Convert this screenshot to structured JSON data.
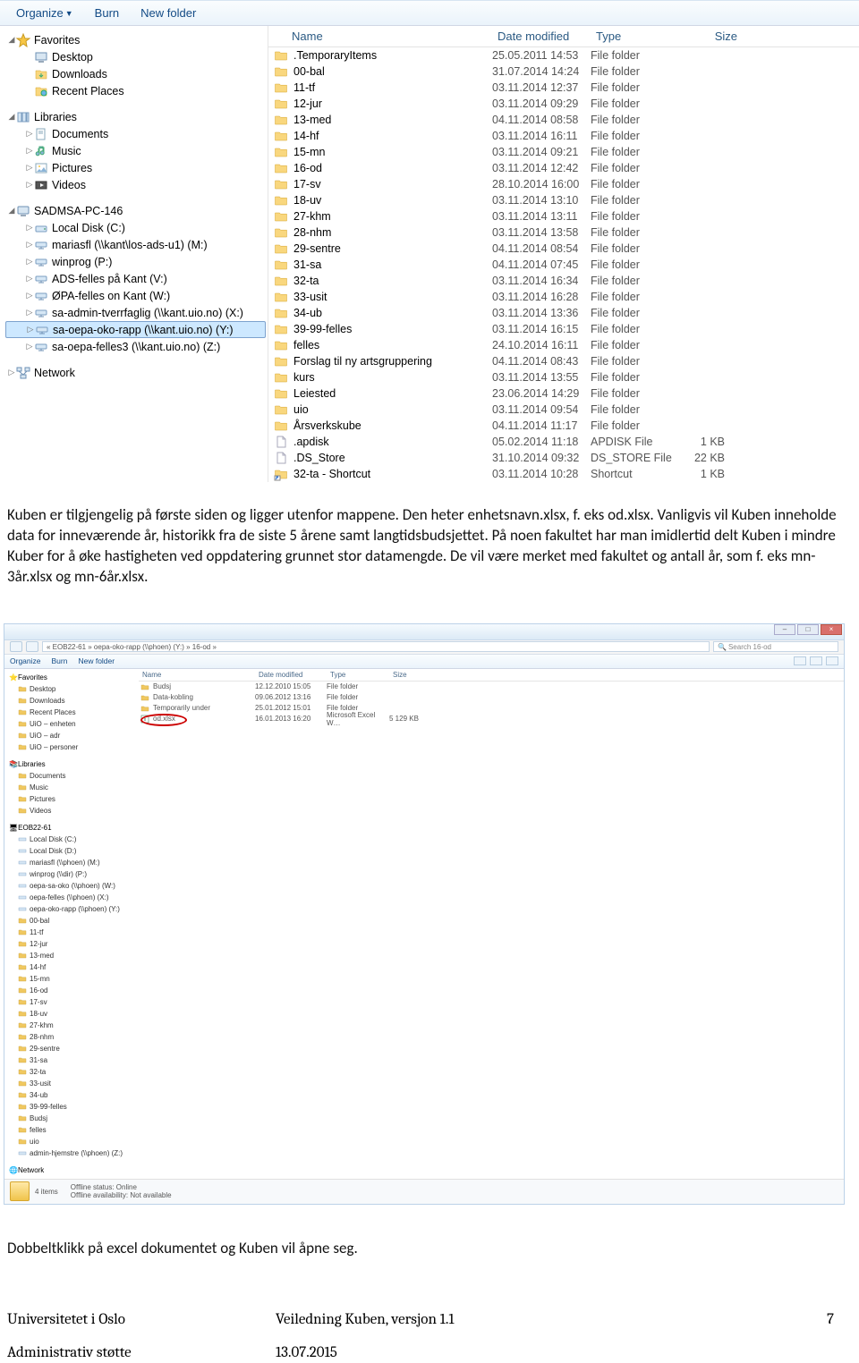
{
  "toolbar": {
    "organize": "Organize",
    "burn": "Burn",
    "newfolder": "New folder"
  },
  "navpane": {
    "favorites": {
      "header": "Favorites",
      "items": [
        "Desktop",
        "Downloads",
        "Recent Places"
      ]
    },
    "libraries": {
      "header": "Libraries",
      "items": [
        "Documents",
        "Music",
        "Pictures",
        "Videos"
      ]
    },
    "computer": {
      "header": "SADMSA-PC-146",
      "items": [
        "Local Disk (C:)",
        "mariasfl (\\\\kant\\los-ads-u1) (M:)",
        "winprog (P:)",
        "ADS-felles på Kant (V:)",
        "ØPA-felles on Kant (W:)",
        "sa-admin-tverrfaglig (\\\\kant.uio.no) (X:)",
        "sa-oepa-oko-rapp (\\\\kant.uio.no) (Y:)",
        "sa-oepa-felles3 (\\\\kant.uio.no) (Z:)"
      ],
      "selectedIndex": 6
    },
    "network": {
      "header": "Network"
    }
  },
  "columns": {
    "name": "Name",
    "date": "Date modified",
    "type": "Type",
    "size": "Size"
  },
  "rows": [
    {
      "name": ".TemporaryItems",
      "date": "25.05.2011 14:53",
      "type": "File folder",
      "size": "",
      "kind": "folder"
    },
    {
      "name": "00-bal",
      "date": "31.07.2014 14:24",
      "type": "File folder",
      "size": "",
      "kind": "folder"
    },
    {
      "name": "11-tf",
      "date": "03.11.2014 12:37",
      "type": "File folder",
      "size": "",
      "kind": "folder"
    },
    {
      "name": "12-jur",
      "date": "03.11.2014 09:29",
      "type": "File folder",
      "size": "",
      "kind": "folder"
    },
    {
      "name": "13-med",
      "date": "04.11.2014 08:58",
      "type": "File folder",
      "size": "",
      "kind": "folder"
    },
    {
      "name": "14-hf",
      "date": "03.11.2014 16:11",
      "type": "File folder",
      "size": "",
      "kind": "folder"
    },
    {
      "name": "15-mn",
      "date": "03.11.2014 09:21",
      "type": "File folder",
      "size": "",
      "kind": "folder"
    },
    {
      "name": "16-od",
      "date": "03.11.2014 12:42",
      "type": "File folder",
      "size": "",
      "kind": "folder"
    },
    {
      "name": "17-sv",
      "date": "28.10.2014 16:00",
      "type": "File folder",
      "size": "",
      "kind": "folder"
    },
    {
      "name": "18-uv",
      "date": "03.11.2014 13:10",
      "type": "File folder",
      "size": "",
      "kind": "folder"
    },
    {
      "name": "27-khm",
      "date": "03.11.2014 13:11",
      "type": "File folder",
      "size": "",
      "kind": "folder"
    },
    {
      "name": "28-nhm",
      "date": "03.11.2014 13:58",
      "type": "File folder",
      "size": "",
      "kind": "folder"
    },
    {
      "name": "29-sentre",
      "date": "04.11.2014 08:54",
      "type": "File folder",
      "size": "",
      "kind": "folder"
    },
    {
      "name": "31-sa",
      "date": "04.11.2014 07:45",
      "type": "File folder",
      "size": "",
      "kind": "folder"
    },
    {
      "name": "32-ta",
      "date": "03.11.2014 16:34",
      "type": "File folder",
      "size": "",
      "kind": "folder"
    },
    {
      "name": "33-usit",
      "date": "03.11.2014 16:28",
      "type": "File folder",
      "size": "",
      "kind": "folder"
    },
    {
      "name": "34-ub",
      "date": "03.11.2014 13:36",
      "type": "File folder",
      "size": "",
      "kind": "folder"
    },
    {
      "name": "39-99-felles",
      "date": "03.11.2014 16:15",
      "type": "File folder",
      "size": "",
      "kind": "folder"
    },
    {
      "name": "felles",
      "date": "24.10.2014 16:11",
      "type": "File folder",
      "size": "",
      "kind": "folder"
    },
    {
      "name": "Forslag til ny artsgruppering",
      "date": "04.11.2014 08:43",
      "type": "File folder",
      "size": "",
      "kind": "folder"
    },
    {
      "name": "kurs",
      "date": "03.11.2014 13:55",
      "type": "File folder",
      "size": "",
      "kind": "folder"
    },
    {
      "name": "Leiested",
      "date": "23.06.2014 14:29",
      "type": "File folder",
      "size": "",
      "kind": "folder"
    },
    {
      "name": "uio",
      "date": "03.11.2014 09:54",
      "type": "File folder",
      "size": "",
      "kind": "folder"
    },
    {
      "name": "Årsverkskube",
      "date": "04.11.2014 11:17",
      "type": "File folder",
      "size": "",
      "kind": "folder"
    },
    {
      "name": ".apdisk",
      "date": "05.02.2014 11:18",
      "type": "APDISK File",
      "size": "1 KB",
      "kind": "file"
    },
    {
      "name": ".DS_Store",
      "date": "31.10.2014 09:32",
      "type": "DS_STORE File",
      "size": "22 KB",
      "kind": "file"
    },
    {
      "name": "32-ta - Shortcut",
      "date": "03.11.2014 10:28",
      "type": "Shortcut",
      "size": "1 KB",
      "kind": "shortcut"
    }
  ],
  "doc": {
    "p1": "Kuben er tilgjengelig på første siden og ligger utenfor mappene. Den heter enhetsnavn.xlsx,  f. eks od.xlsx.  Vanligvis vil Kuben inneholde data for inneværende år, historikk fra de siste 5 årene samt langtidsbudsjettet. På noen fakultet har man imidlertid delt Kuben i mindre Kuber for å øke hastigheten ved oppdatering grunnet stor datamengde. De vil være merket med fakultet og antall år, som f. eks mn-3år.xlsx og mn-6år.xlsx.",
    "p2": "Dobbeltklikk på excel dokumentet og Kuben vil åpne seg."
  },
  "explorer2": {
    "crumb": "« EOB22-61 » oepa-oko-rapp (\\\\phoen) (Y:) » 16-od »",
    "search_placeholder": "Search 16-od",
    "toolbar": {
      "organize": "Organize",
      "burn": "Burn",
      "newfolder": "New folder"
    },
    "nav_favorites": {
      "header": "Favorites",
      "items": [
        "Desktop",
        "Downloads",
        "Recent Places",
        "UiO – enheten",
        "UiO – adr",
        "UiO – personer"
      ]
    },
    "nav_libraries": {
      "header": "Libraries",
      "items": [
        "Documents",
        "Music",
        "Pictures",
        "Videos"
      ]
    },
    "nav_computer": {
      "header": "EOB22-61",
      "items": [
        "Local Disk (C:)",
        "Local Disk (D:)",
        "mariasfl (\\\\phoen) (M:)",
        "winprog (\\\\dir) (P:)",
        "oepa-sa-oko (\\\\phoen) (W:)",
        "oepa-felles (\\\\phoen) (X:)",
        "oepa-oko-rapp (\\\\phoen) (Y:)",
        "00-bal",
        "11-tf",
        "12-jur",
        "13-med",
        "14-hf",
        "15-mn",
        "16-od",
        "17-sv",
        "18-uv",
        "27-khm",
        "28-nhm",
        "29-sentre",
        "31-sa",
        "32-ta",
        "33-usit",
        "34-ub",
        "39-99-felles",
        "Budsj",
        "felles",
        "uio",
        "admin-hjemstre (\\\\phoen) (Z:)"
      ]
    },
    "nav_network": {
      "header": "Network"
    },
    "columns": {
      "name": "Name",
      "date": "Date modified",
      "type": "Type",
      "size": "Size"
    },
    "rows": [
      {
        "name": "Budsj",
        "date": "12.12.2010 15:05",
        "type": "File folder",
        "size": ""
      },
      {
        "name": "Data-kobling",
        "date": "09.06.2012 13:16",
        "type": "File folder",
        "size": ""
      },
      {
        "name": "Temporarily under",
        "date": "25.01.2012 15:01",
        "type": "File folder",
        "size": ""
      },
      {
        "name": "od.xlsx",
        "date": "16.01.2013 16:20",
        "type": "Microsoft Excel W…",
        "size": "5 129 KB"
      }
    ],
    "status": {
      "count": "4 items",
      "offline_status": "Offline status: Online",
      "offline_avail": "Offline availability: Not available"
    }
  },
  "footer": {
    "left": "Universitetet i Oslo",
    "center": "Veiledning Kuben, versjon 1.1",
    "right": "7",
    "left2": "Administrativ støtte",
    "center2": "13.07.2015"
  }
}
